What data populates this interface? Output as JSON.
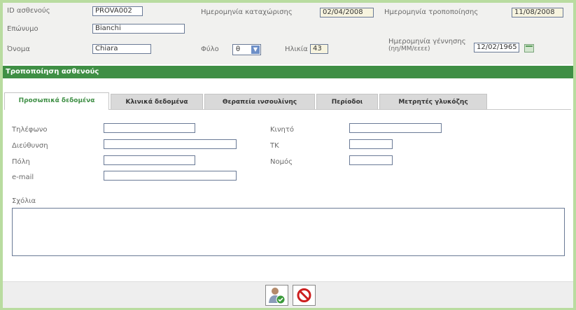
{
  "header": {
    "patient_id_label": "ID ασθενούς",
    "patient_id_value": "PROVA002",
    "registration_date_label": "Ημερομηνία καταχώρισης",
    "registration_date_value": "02/04/2008",
    "modification_date_label": "Ημερομηνία τροποποίησης",
    "modification_date_value": "11/08/2008",
    "surname_label": "Επώνυμο",
    "surname_value": "Bianchi",
    "name_label": "Όνομα",
    "name_value": "Chiara",
    "sex_label": "Φύλο",
    "sex_value": "θ",
    "age_label": "Ηλικία",
    "age_value": "43",
    "birthdate_label": "Ημερομηνία γέννησης",
    "birthdate_format": "(ηη/ΜΜ/εεεε)",
    "birthdate_value": "12/02/1965"
  },
  "section_title": "Τροποποίηση ασθενούς",
  "tabs": [
    {
      "label": "Προσωπικά δεδομένα",
      "active": true
    },
    {
      "label": "Κλινικά δεδομένα",
      "active": false
    },
    {
      "label": "Θεραπεία ινσουλίνης",
      "active": false
    },
    {
      "label": "Περίοδοι",
      "active": false
    },
    {
      "label": "Μετρητές γλυκόζης",
      "active": false
    }
  ],
  "form": {
    "phone_label": "Τηλέφωνο",
    "address_label": "Διεύθυνση",
    "city_label": "Πόλη",
    "email_label": "e-mail",
    "mobile_label": "Κινητό",
    "postal_code_label": "ΤΚ",
    "prefecture_label": "Νομός",
    "comments_label": "Σχόλια",
    "phone_value": "",
    "address_value": "",
    "city_value": "",
    "email_value": "",
    "mobile_value": "",
    "postal_code_value": "",
    "prefecture_value": "",
    "comments_value": ""
  },
  "buttons": {
    "save_icon": "user-check-icon",
    "cancel_icon": "prohibited-icon"
  },
  "colors": {
    "accent_green": "#3f8f45",
    "frame_green": "#b9dca0",
    "cancel_red": "#cc1f1f"
  }
}
